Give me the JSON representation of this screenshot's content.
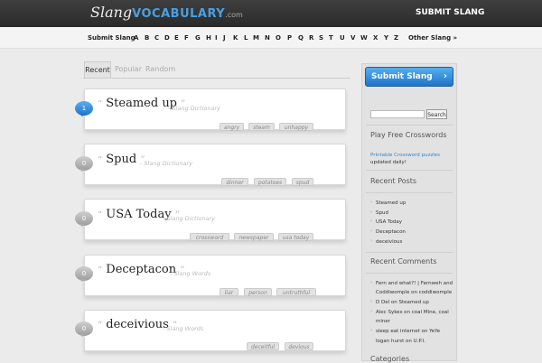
{
  "header": {
    "logo_slang": "Slang",
    "logo_vocab": "VOCABULARY",
    "logo_com": ".com",
    "submit_label": "SUBMIT SLANG"
  },
  "alphabet": {
    "first": "Submit Slang",
    "letters": [
      "A",
      "B",
      "C",
      "D",
      "E",
      "F",
      "G",
      "H",
      "I",
      "J",
      "K",
      "L",
      "M",
      "N",
      "O",
      "P",
      "Q",
      "R",
      "S",
      "T",
      "U",
      "V",
      "W",
      "X",
      "Y",
      "Z"
    ],
    "last": "Other Slang »"
  },
  "tabs": [
    "Recent",
    "Popular",
    "Random"
  ],
  "posts": [
    {
      "count": "1",
      "title": "Steamed up",
      "category": "- Slang Dictionary",
      "tags": [
        "angry",
        "steam",
        "unhappy"
      ]
    },
    {
      "count": "0",
      "title": "Spud",
      "category": "- Slang Dictionary",
      "tags": [
        "dinner",
        "potatoes",
        "spud"
      ]
    },
    {
      "count": "0",
      "title": "USA Today",
      "category": "- Slang Dictionary",
      "tags": [
        "crossword",
        "newspaper",
        "usa today"
      ]
    },
    {
      "count": "0",
      "title": "Deceptacon",
      "category": "- Slang Words",
      "tags": [
        "liar",
        "person",
        "untruthful"
      ]
    },
    {
      "count": "0",
      "title": "deceivious",
      "category": "- Slang Words",
      "tags": [
        "deceitful",
        "devious"
      ]
    }
  ],
  "sidebar": {
    "submit_button": "Submit Slang",
    "search_button": "Search",
    "crosswords_heading": "Play Free Crosswords",
    "crosswords_link": "Printable Crossword puzzles",
    "crosswords_text": "updated daily!",
    "recent_posts_heading": "Recent Posts",
    "recent_posts": [
      "Steamed up",
      "Spud",
      "USA Today",
      "Deceptacon",
      "deceivious"
    ],
    "recent_comments_heading": "Recent Comments",
    "recent_comments": [
      "Fern and what?! | Fernweh and",
      "Coddiwomple on coddiwomple",
      "D Del on Steamed up",
      "Alec Sykes on coal Mine, coal",
      "miner",
      "sleep eat internet on YeYe",
      "logan hurst on U.P.I."
    ],
    "categories_heading": "Categories"
  },
  "colors": {
    "accent": "#2a86d8",
    "topbar": "#333333"
  }
}
